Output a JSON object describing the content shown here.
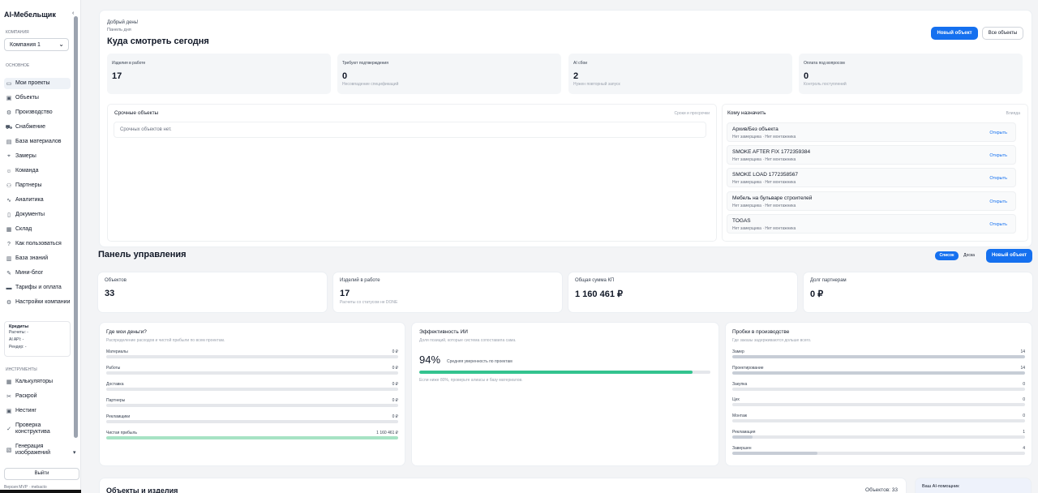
{
  "sidebar": {
    "brand": "AI-Мебельщик",
    "company_section": "КОМПАНИЯ",
    "company_value": "Компания 1",
    "main_section": "ОСНОВНОЕ",
    "items": [
      {
        "label": "Мои проекты",
        "icon": "folder-icon",
        "glyph": "▭"
      },
      {
        "label": "Объекты",
        "icon": "building-icon",
        "glyph": "▣"
      },
      {
        "label": "Производство",
        "icon": "factory-icon",
        "glyph": "⚙"
      },
      {
        "label": "Снабжение",
        "icon": "truck-icon",
        "glyph": "⛟"
      },
      {
        "label": "База материалов",
        "icon": "database-icon",
        "glyph": "▤"
      },
      {
        "label": "Замеры",
        "icon": "ruler-icon",
        "glyph": "⌖"
      },
      {
        "label": "Команда",
        "icon": "users-icon",
        "glyph": "☺"
      },
      {
        "label": "Партнеры",
        "icon": "handshake-icon",
        "glyph": "⚇"
      },
      {
        "label": "Аналитика",
        "icon": "chart-icon",
        "glyph": "∿"
      },
      {
        "label": "Документы",
        "icon": "document-icon",
        "glyph": "▯"
      },
      {
        "label": "Склад",
        "icon": "warehouse-icon",
        "glyph": "▦"
      },
      {
        "label": "Как пользоваться",
        "icon": "help-icon",
        "glyph": "?"
      },
      {
        "label": "База знаний",
        "icon": "book-icon",
        "glyph": "▥"
      },
      {
        "label": "Мини-блог",
        "icon": "blog-icon",
        "glyph": "✎"
      },
      {
        "label": "Тарифы и оплата",
        "icon": "card-icon",
        "glyph": "▬"
      },
      {
        "label": "Настройки компании",
        "icon": "settings-icon",
        "glyph": "⚙"
      }
    ],
    "credits": {
      "title": "Кредиты",
      "rows": [
        "Расчеты: -",
        "AI API: -",
        "Рендер: -"
      ]
    },
    "tools_section": "ИНСТРУМЕНТЫ",
    "tools": [
      {
        "label": "Калькуляторы",
        "icon": "calculator-icon",
        "glyph": "▦"
      },
      {
        "label": "Раскрой",
        "icon": "scissors-icon",
        "glyph": "✂"
      },
      {
        "label": "Нестинг",
        "icon": "nesting-icon",
        "glyph": "▣"
      },
      {
        "label": "Проверка конструктива",
        "icon": "check-icon",
        "glyph": "✓"
      },
      {
        "label": "Генерация изображений",
        "icon": "image-icon",
        "glyph": "▧"
      }
    ],
    "logout": "Выйти",
    "version": "Версия MVP · mebacto"
  },
  "today": {
    "greeting": "Добрый день!",
    "subtitle": "Панель дня",
    "title": "Куда смотреть сегодня",
    "new_button": "Новый объект",
    "all_button": "Все объекты",
    "stats": [
      {
        "label": "Изделия в работе",
        "value": "17",
        "sub": ""
      },
      {
        "label": "Требуют подтверждения",
        "value": "0",
        "sub": "Несовпадение спецификаций"
      },
      {
        "label": "AI сбои",
        "value": "2",
        "sub": "Нужен повторный запуск"
      },
      {
        "label": "Оплата под вопросом",
        "value": "0",
        "sub": "Контроль поступлений"
      }
    ],
    "urgent": {
      "title": "Срочные объекты",
      "hint": "Сроки и просрочки",
      "empty": "Срочных объектов нет."
    },
    "assign": {
      "title": "Кому назначить",
      "hint": "Влияда",
      "items": [
        {
          "name": "Архив/Без объекта",
          "status": "Нет замерщика · Нет монтажника",
          "action": "Открыть"
        },
        {
          "name": "SMOKE AFTER FIX 1772359384",
          "status": "Нет замерщика · Нет монтажника",
          "action": "Открыть"
        },
        {
          "name": "SMOKE LOAD 1772358567",
          "status": "Нет замерщика · Нет монтажника",
          "action": "Открыть"
        },
        {
          "name": "Мебель на бульваре строителей",
          "status": "Нет замерщика · Нет монтажника",
          "action": "Открыть"
        },
        {
          "name": "TOGAS",
          "status": "Нет замерщика · Нет монтажника",
          "action": "Открыть"
        }
      ]
    }
  },
  "control": {
    "title": "Панель управления",
    "view_list": "Список",
    "view_board": "Доска",
    "new_button": "Новый объект",
    "kpis": [
      {
        "label": "Объектов",
        "value": "33",
        "sub": ""
      },
      {
        "label": "Изделий в работе",
        "value": "17",
        "sub": "Расчеты со статусом не DONE"
      },
      {
        "label": "Общая сумма КП",
        "value": "1 160 461 ₽",
        "sub": ""
      },
      {
        "label": "Долг партнерам",
        "value": "0 ₽",
        "sub": ""
      }
    ],
    "money": {
      "title": "Где мои деньги?",
      "subtitle": "Распределение расходов и чистой прибыли по всем проектам.",
      "rows": [
        {
          "label": "Материалы",
          "value": "0 ₽",
          "fraction": 0
        },
        {
          "label": "Работы",
          "value": "0 ₽",
          "fraction": 0
        },
        {
          "label": "Доставка",
          "value": "0 ₽",
          "fraction": 0
        },
        {
          "label": "Партнеры",
          "value": "0 ₽",
          "fraction": 0
        },
        {
          "label": "Рекламщики",
          "value": "0 ₽",
          "fraction": 0
        },
        {
          "label": "Чистая прибыль",
          "value": "1 160 461 ₽",
          "fraction": 1,
          "color": "#a7e3c4"
        }
      ]
    },
    "ai": {
      "title": "Эффективность ИИ",
      "subtitle": "Доля позиций, которые система сопоставила сама.",
      "percent": "94%",
      "label": "Средняя уверенность по проектам",
      "fraction": 0.94,
      "color": "#34c38f",
      "note": "Если ниже 80%, проверьте алиасы и базу материалов."
    },
    "jams": {
      "title": "Пробки в производстве",
      "subtitle": "Где заказы задерживаются дольше всего.",
      "rows": [
        {
          "label": "Замер",
          "value": "14",
          "fraction": 1
        },
        {
          "label": "Проектирование",
          "value": "14",
          "fraction": 1
        },
        {
          "label": "Закупка",
          "value": "0",
          "fraction": 0
        },
        {
          "label": "Цех",
          "value": "0",
          "fraction": 0
        },
        {
          "label": "Монтаж",
          "value": "0",
          "fraction": 0
        },
        {
          "label": "Рекламация",
          "value": "1",
          "fraction": 0.07
        },
        {
          "label": "Завершен",
          "value": "4",
          "fraction": 0.29
        }
      ],
      "color": "#c7cdd6"
    }
  },
  "objects": {
    "title": "Объекты и изделия",
    "count": "Объектов: 33"
  },
  "assistant": {
    "title": "Ваш AI-помощник"
  }
}
